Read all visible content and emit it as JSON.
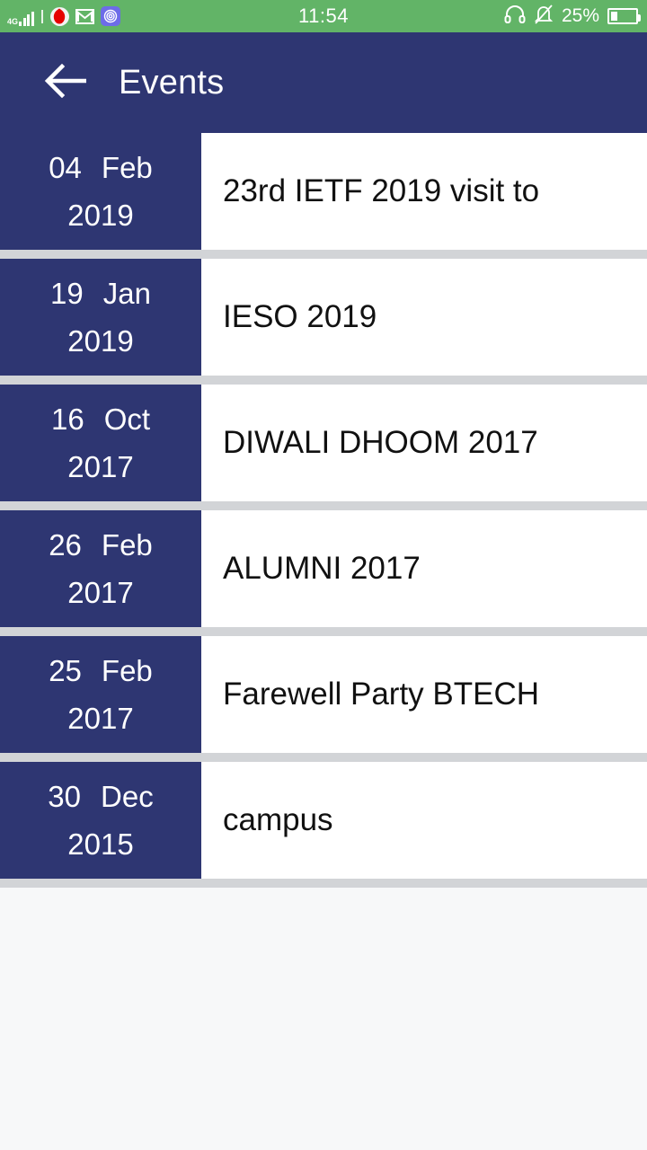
{
  "status_bar": {
    "network_label": "4G",
    "carrier_icon": "vodafone-icon",
    "mail_icon": "gmail-icon",
    "app_icon": "spiral-app-icon",
    "clock": "11:54",
    "headset_icon": "headset-icon",
    "mute_icon": "bell-muted-icon",
    "battery_percent": "25%",
    "battery_fill": 25,
    "background_color": "#62b467"
  },
  "app_bar": {
    "back_icon": "arrow-left-icon",
    "title": "Events",
    "background_color": "#2e3672"
  },
  "events": [
    {
      "day": "04",
      "month": "Feb",
      "year": "2019",
      "title": "23rd IETF 2019 visit to"
    },
    {
      "day": "19",
      "month": "Jan",
      "year": "2019",
      "title": "IESO 2019"
    },
    {
      "day": "16",
      "month": "Oct",
      "year": "2017",
      "title": "DIWALI DHOOM 2017"
    },
    {
      "day": "26",
      "month": "Feb",
      "year": "2017",
      "title": "ALUMNI 2017"
    },
    {
      "day": "25",
      "month": "Feb",
      "year": "2017",
      "title": "Farewell Party BTECH"
    },
    {
      "day": "30",
      "month": "Dec",
      "year": "2015",
      "title": "campus"
    }
  ],
  "colors": {
    "accent_navy": "#2e3672",
    "status_green": "#62b467",
    "row_separator": "#d2d4d7",
    "page_background": "#f7f8f9",
    "row_background": "#ffffff",
    "title_text": "#111111"
  }
}
